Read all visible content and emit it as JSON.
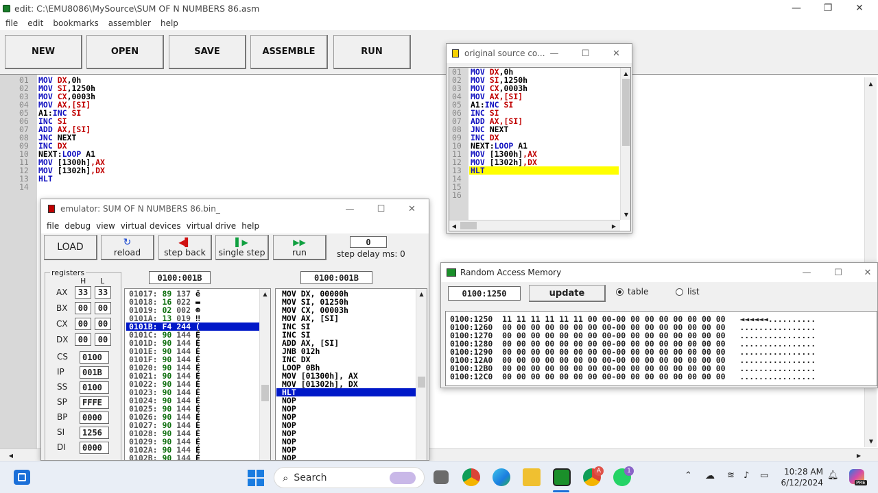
{
  "main": {
    "title": "edit: C:\\EMU8086\\MySource\\SUM OF N NUMBERS 86.asm",
    "menu": [
      "file",
      "edit",
      "bookmarks",
      "assembler",
      "help"
    ],
    "toolbar": [
      "NEW",
      "OPEN",
      "SAVE",
      "ASSEMBLE",
      "RUN"
    ],
    "line_numbers": [
      "01",
      "02",
      "03",
      "04",
      "05",
      "06",
      "07",
      "08",
      "09",
      "10",
      "11",
      "12",
      "13",
      "14"
    ],
    "code": [
      [
        [
          "MOV ",
          "kw"
        ],
        [
          "DX",
          "rg"
        ],
        [
          ",0h",
          "nm"
        ]
      ],
      [
        [
          "MOV ",
          "kw"
        ],
        [
          "SI",
          "rg"
        ],
        [
          ",1250h",
          "nm"
        ]
      ],
      [
        [
          "MOV ",
          "kw"
        ],
        [
          "CX",
          "rg"
        ],
        [
          ",0003h",
          "nm"
        ]
      ],
      [
        [
          "MOV ",
          "kw"
        ],
        [
          "AX",
          "rg"
        ],
        [
          ",[SI]",
          "rg"
        ]
      ],
      [
        [
          "A1:",
          "nm"
        ],
        [
          "INC ",
          "kw"
        ],
        [
          "SI",
          "rg"
        ]
      ],
      [
        [
          "INC ",
          "kw"
        ],
        [
          "SI",
          "rg"
        ]
      ],
      [
        [
          "ADD ",
          "kw"
        ],
        [
          "AX",
          "rg"
        ],
        [
          ",[SI]",
          "rg"
        ]
      ],
      [
        [
          "JNC ",
          "kw"
        ],
        [
          "NEXT",
          "nm"
        ]
      ],
      [
        [
          "INC ",
          "kw"
        ],
        [
          "DX",
          "rg"
        ]
      ],
      [
        [
          "NEXT:",
          "nm"
        ],
        [
          "LOOP ",
          "kw"
        ],
        [
          "A1",
          "nm"
        ]
      ],
      [
        [
          "MOV ",
          "kw"
        ],
        [
          "[1300h]",
          "nm"
        ],
        [
          ",AX",
          "rg"
        ]
      ],
      [
        [
          "MOV ",
          "kw"
        ],
        [
          "[1302h]",
          "nm"
        ],
        [
          ",DX",
          "rg"
        ]
      ],
      [
        [
          "HLT",
          "kw"
        ]
      ],
      []
    ]
  },
  "source_window": {
    "title": "original source co...",
    "line_numbers": [
      "01",
      "02",
      "03",
      "04",
      "05",
      "06",
      "07",
      "08",
      "09",
      "10",
      "11",
      "12",
      "13",
      "14",
      "15",
      "16"
    ],
    "code": [
      [
        [
          "MOV ",
          "kw"
        ],
        [
          "DX",
          "rg"
        ],
        [
          ",0h",
          "nm"
        ]
      ],
      [
        [
          "MOV ",
          "kw"
        ],
        [
          "SI",
          "rg"
        ],
        [
          ",1250h",
          "nm"
        ]
      ],
      [
        [
          "MOV ",
          "kw"
        ],
        [
          "CX",
          "rg"
        ],
        [
          ",0003h",
          "nm"
        ]
      ],
      [
        [
          "MOV ",
          "kw"
        ],
        [
          "AX",
          "rg"
        ],
        [
          ",[SI]",
          "rg"
        ]
      ],
      [
        [
          "A1:",
          "nm"
        ],
        [
          "INC ",
          "kw"
        ],
        [
          "SI",
          "rg"
        ]
      ],
      [
        [
          "INC ",
          "kw"
        ],
        [
          "SI",
          "rg"
        ]
      ],
      [
        [
          "ADD ",
          "kw"
        ],
        [
          "AX",
          "rg"
        ],
        [
          ",[SI]",
          "rg"
        ]
      ],
      [
        [
          "JNC ",
          "kw"
        ],
        [
          "NEXT",
          "nm"
        ]
      ],
      [
        [
          "INC ",
          "kw"
        ],
        [
          "DX",
          "rg"
        ]
      ],
      [
        [
          "NEXT:",
          "nm"
        ],
        [
          "LOOP ",
          "kw"
        ],
        [
          "A1",
          "nm"
        ]
      ],
      [
        [
          "MOV ",
          "kw"
        ],
        [
          "[1300h]",
          "nm"
        ],
        [
          ",AX",
          "rg"
        ]
      ],
      [
        [
          "MOV ",
          "kw"
        ],
        [
          "[1302h]",
          "nm"
        ],
        [
          ",DX",
          "rg"
        ]
      ],
      [
        [
          "HLT",
          "kw"
        ]
      ],
      [],
      [],
      []
    ],
    "highlight_line": 12
  },
  "emulator": {
    "title": "emulator: SUM OF N NUMBERS 86.bin_",
    "menu": [
      "file",
      "debug",
      "view",
      "virtual devices",
      "virtual drive",
      "help"
    ],
    "buttons": {
      "load": "LOAD",
      "reload": "reload",
      "step_back": "step back",
      "single_step": "single step",
      "run": "run"
    },
    "step_delay_value": "0",
    "step_delay_label": "step delay ms: 0",
    "registers_label": "registers",
    "h_label": "H",
    "l_label": "L",
    "regs8": [
      {
        "name": "AX",
        "h": "33",
        "l": "33"
      },
      {
        "name": "BX",
        "h": "00",
        "l": "00"
      },
      {
        "name": "CX",
        "h": "00",
        "l": "00"
      },
      {
        "name": "DX",
        "h": "00",
        "l": "00"
      }
    ],
    "regs16": [
      {
        "name": "CS",
        "value": "0100"
      },
      {
        "name": "IP",
        "value": "001B"
      },
      {
        "name": "SS",
        "value": "0100"
      },
      {
        "name": "SP",
        "value": "FFFE"
      },
      {
        "name": "BP",
        "value": "0000"
      },
      {
        "name": "SI",
        "value": "1256"
      },
      {
        "name": "DI",
        "value": "0000"
      }
    ],
    "addr_left": "0100:001B",
    "addr_right": "0100:001B",
    "memory_rows": [
      {
        "addr": "01017:",
        "hex": "89",
        "dec": "137",
        "ch": "ë"
      },
      {
        "addr": "01018:",
        "hex": "16",
        "dec": "022",
        "ch": "▬"
      },
      {
        "addr": "01019:",
        "hex": "02",
        "dec": "002",
        "ch": "☻"
      },
      {
        "addr": "0101A:",
        "hex": "13",
        "dec": "019",
        "ch": "‼"
      },
      {
        "addr": "0101B:",
        "hex": "F4",
        "dec": "244",
        "ch": "(",
        "selected": true
      },
      {
        "addr": "0101C:",
        "hex": "90",
        "dec": "144",
        "ch": "É"
      },
      {
        "addr": "0101D:",
        "hex": "90",
        "dec": "144",
        "ch": "É"
      },
      {
        "addr": "0101E:",
        "hex": "90",
        "dec": "144",
        "ch": "É"
      },
      {
        "addr": "0101F:",
        "hex": "90",
        "dec": "144",
        "ch": "É"
      },
      {
        "addr": "01020:",
        "hex": "90",
        "dec": "144",
        "ch": "É"
      },
      {
        "addr": "01021:",
        "hex": "90",
        "dec": "144",
        "ch": "É"
      },
      {
        "addr": "01022:",
        "hex": "90",
        "dec": "144",
        "ch": "É"
      },
      {
        "addr": "01023:",
        "hex": "90",
        "dec": "144",
        "ch": "É"
      },
      {
        "addr": "01024:",
        "hex": "90",
        "dec": "144",
        "ch": "É"
      },
      {
        "addr": "01025:",
        "hex": "90",
        "dec": "144",
        "ch": "É"
      },
      {
        "addr": "01026:",
        "hex": "90",
        "dec": "144",
        "ch": "É"
      },
      {
        "addr": "01027:",
        "hex": "90",
        "dec": "144",
        "ch": "É"
      },
      {
        "addr": "01028:",
        "hex": "90",
        "dec": "144",
        "ch": "É"
      },
      {
        "addr": "01029:",
        "hex": "90",
        "dec": "144",
        "ch": "É"
      },
      {
        "addr": "0102A:",
        "hex": "90",
        "dec": "144",
        "ch": "É"
      },
      {
        "addr": "0102B:",
        "hex": "90",
        "dec": "144",
        "ch": "É"
      }
    ],
    "disasm": [
      {
        "text": "MOV DX, 00000h"
      },
      {
        "text": "MOV SI, 01250h"
      },
      {
        "text": "MOV CX, 00003h"
      },
      {
        "text": "MOV AX, [SI]"
      },
      {
        "text": "INC SI"
      },
      {
        "text": "INC SI"
      },
      {
        "text": "ADD AX, [SI]"
      },
      {
        "text": "JNB 012h"
      },
      {
        "text": "INC DX"
      },
      {
        "text": "LOOP 0Bh"
      },
      {
        "text": "MOV [01300h], AX"
      },
      {
        "text": "MOV [01302h], DX"
      },
      {
        "text": "HLT",
        "selected": true
      },
      {
        "text": "NOP"
      },
      {
        "text": "NOP"
      },
      {
        "text": "NOP"
      },
      {
        "text": "NOP"
      },
      {
        "text": "NOP"
      },
      {
        "text": "NOP"
      },
      {
        "text": "NOP"
      },
      {
        "text": "NOP"
      }
    ]
  },
  "ram": {
    "title": "Random Access Memory",
    "address": "0100:1250",
    "update_label": "update",
    "table_label": "table",
    "list_label": "list",
    "selected_view": "table",
    "rows": [
      {
        "addr": "0100:1250",
        "bytes": "11 11 11 11 11 11 00 00-00 00 00 00 00 00 00 00",
        "ascii": "◄◄◄◄◄◄.........."
      },
      {
        "addr": "0100:1260",
        "bytes": "00 00 00 00 00 00 00 00-00 00 00 00 00 00 00 00",
        "ascii": "................"
      },
      {
        "addr": "0100:1270",
        "bytes": "00 00 00 00 00 00 00 00-00 00 00 00 00 00 00 00",
        "ascii": "................"
      },
      {
        "addr": "0100:1280",
        "bytes": "00 00 00 00 00 00 00 00-00 00 00 00 00 00 00 00",
        "ascii": "................"
      },
      {
        "addr": "0100:1290",
        "bytes": "00 00 00 00 00 00 00 00-00 00 00 00 00 00 00 00",
        "ascii": "................"
      },
      {
        "addr": "0100:12A0",
        "bytes": "00 00 00 00 00 00 00 00-00 00 00 00 00 00 00 00",
        "ascii": "................"
      },
      {
        "addr": "0100:12B0",
        "bytes": "00 00 00 00 00 00 00 00-00 00 00 00 00 00 00 00",
        "ascii": "................"
      },
      {
        "addr": "0100:12C0",
        "bytes": "00 00 00 00 00 00 00 00-00 00 00 00 00 00 00 00",
        "ascii": "................"
      }
    ]
  },
  "taskbar": {
    "search_placeholder": "Search",
    "time": "10:28 AM",
    "date": "6/12/2024",
    "chrome_badge": "A",
    "whatsapp_badge": "1",
    "copilot_badge": "PRE"
  },
  "colors": {
    "keyword": "#1010c0",
    "register": "#c00000",
    "selection": "#0018c8",
    "highlight": "#ffff00",
    "hex_green": "#107010"
  }
}
